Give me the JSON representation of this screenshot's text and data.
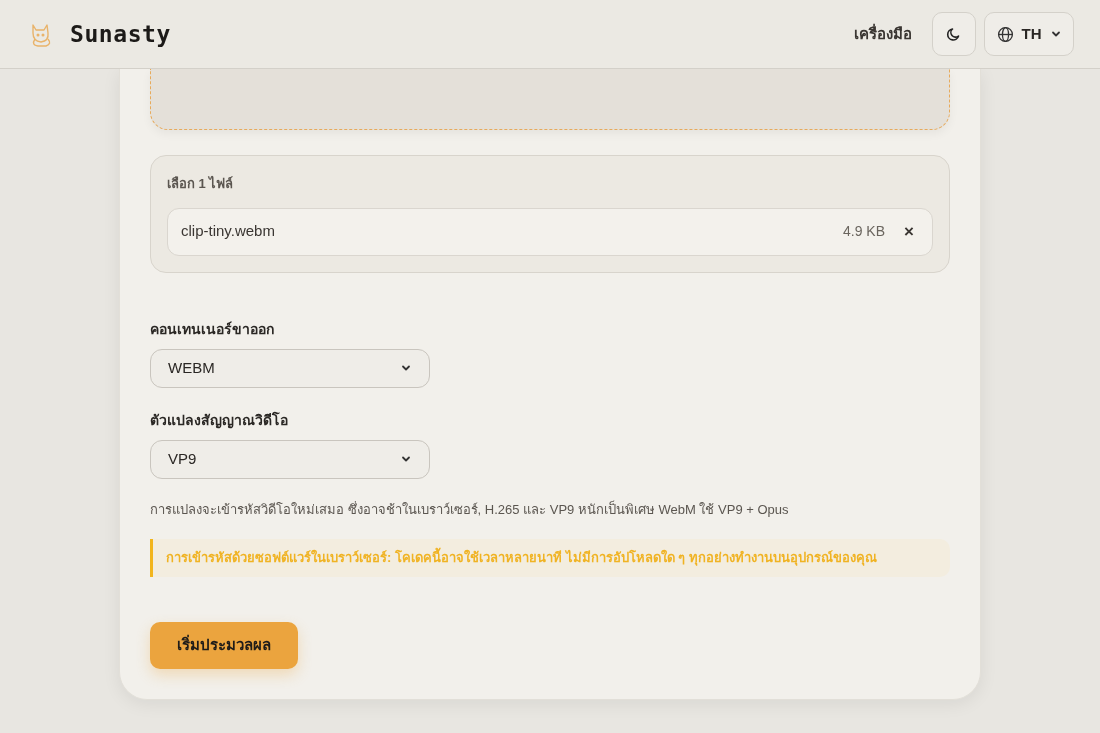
{
  "header": {
    "brand": "Sunasty",
    "nav_link": "เครื่องมือ",
    "language": "TH"
  },
  "files": {
    "heading": "เลือก 1 ไฟล์",
    "items": [
      {
        "name": "clip-tiny.webm",
        "size": "4.9 KB",
        "remove": "×"
      }
    ]
  },
  "fields": [
    {
      "label": "คอนเทนเนอร์ขาออก",
      "value": "WEBM"
    },
    {
      "label": "ตัวแปลงสัญญาณวิดีโอ",
      "value": "VP9"
    }
  ],
  "help_text": "การแปลงจะเข้ารหัสวิดีโอใหม่เสมอ ซึ่งอาจช้าในเบราว์เซอร์, H.265 และ VP9 หนักเป็นพิเศษ WebM ใช้ VP9 + Opus",
  "warning": "การเข้ารหัสด้วยซอฟต์แวร์ในเบราว์เซอร์: โคเดคนี้อาจใช้เวลาหลายนาที ไม่มีการอัปโหลดใด ๆ ทุกอย่างทำงานบนอุปกรณ์ของคุณ",
  "submit": "เริ่มประมวลผล"
}
